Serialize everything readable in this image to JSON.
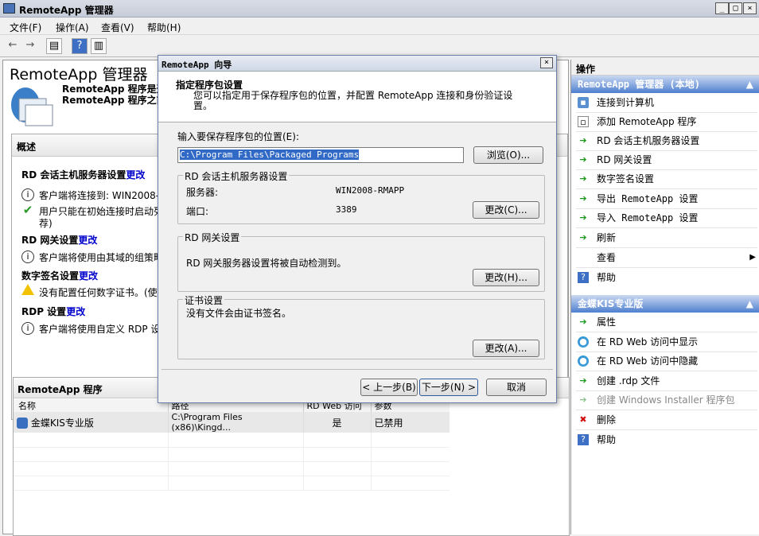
{
  "window": {
    "title": "RemoteApp 管理器",
    "min": "_",
    "max": "□",
    "close": "×"
  },
  "menu": [
    "文件(F)",
    "操作(A)",
    "查看(V)",
    "帮助(H)"
  ],
  "toolbar": {
    "back": "←",
    "forward": "→",
    "panel": "▤",
    "help": "?",
    "view": "▥"
  },
  "header": {
    "title": "RemoteApp 管理器",
    "desc1": "RemoteApp 程序是通过",
    "desc2": "RemoteApp 程序之前"
  },
  "overview": {
    "title": "概述",
    "rd_session": {
      "label": "RD 会话主机服务器设置",
      "change": "更改",
      "line1": "客户端将连接到: WIN2008-R",
      "line2": "用户只能在初始连接时启动列",
      "line3": "荐)"
    },
    "rd_gateway": {
      "label": "RD 网关设置",
      "change": "更改",
      "line1": "客户端将使用由其域的组策略"
    },
    "digital_sig": {
      "label": "数字签名设置",
      "change": "更改",
      "line1": "没有配置任何数字证书。(使"
    },
    "rdp": {
      "label": "RDP 设置",
      "change": "更改",
      "line1": "客户端将使用自定义 RDP 设"
    }
  },
  "programs": {
    "title": "RemoteApp 程序",
    "columns": [
      "名称",
      "路径",
      "RD Web 访问",
      "参数"
    ],
    "rows": [
      {
        "name": "金蝶KIS专业版",
        "path": "C:\\Program Files (x86)\\Kingd...",
        "rdweb": "是",
        "args": "已禁用"
      }
    ]
  },
  "actions": {
    "title": "操作",
    "section1": {
      "title": "RemoteApp 管理器 (本地)",
      "items": [
        "连接到计算机",
        "添加 RemoteApp 程序",
        "RD 会话主机服务器设置",
        "RD 网关设置",
        "数字签名设置",
        "导出 RemoteApp 设置",
        "导入 RemoteApp 设置",
        "刷新",
        "查看",
        "帮助"
      ]
    },
    "section2": {
      "title": "金蝶KIS专业版",
      "items": [
        "属性",
        "在 RD Web 访问中显示",
        "在 RD Web 访问中隐藏",
        "创建 .rdp 文件",
        "创建 Windows Installer 程序包",
        "删除",
        "帮助"
      ]
    },
    "collapse": "▲",
    "submenu_arrow": "▶"
  },
  "dialog": {
    "title": "RemoteApp 向导",
    "close": "×",
    "heading": "指定程序包设置",
    "subheading": "您可以指定用于保存程序包的位置，并配置 RemoteApp 连接和身份验证设置。",
    "location_label": "输入要保存程序包的位置(E):",
    "location_value": "C:\\Program Files\\Packaged Programs",
    "browse": "浏览(O)...",
    "rdsession": {
      "title": "RD 会话主机服务器设置",
      "server_label": "服务器:",
      "server_value": "WIN2008-RMAPP",
      "port_label": "端口:",
      "port_value": "3389",
      "change": "更改(C)..."
    },
    "rdgateway": {
      "title": "RD 网关设置",
      "text": "RD 网关服务器设置将被自动检测到。",
      "change": "更改(H)..."
    },
    "cert": {
      "title": "证书设置",
      "text": "没有文件会由证书签名。",
      "change": "更改(A)..."
    },
    "back": "< 上一步(B)",
    "next": "下一步(N) >",
    "cancel": "取消"
  }
}
